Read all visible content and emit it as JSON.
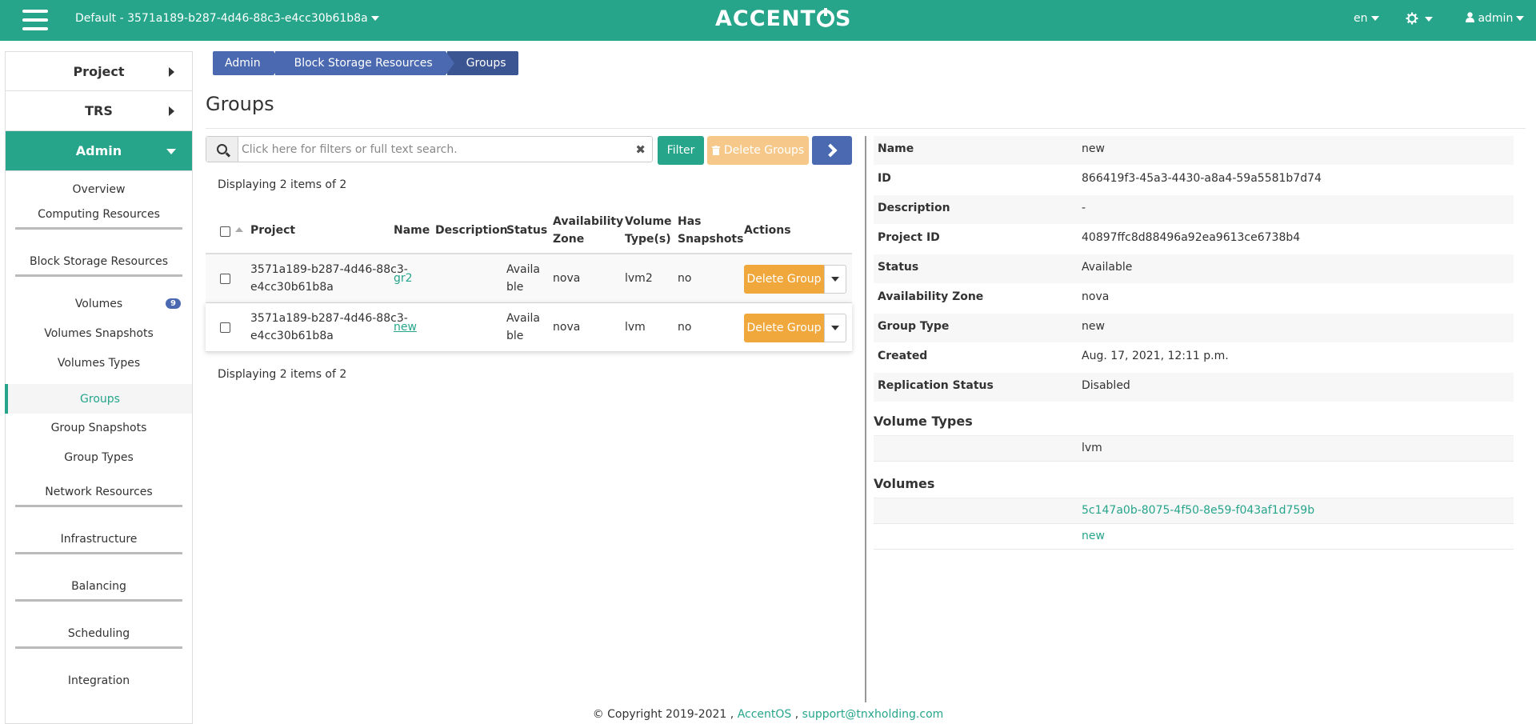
{
  "header": {
    "project_label": "Default - 3571a189-b287-4d46-88c3-e4cc30b61b8a",
    "logo_left": "ACCENT",
    "logo_right": "S",
    "language": "en",
    "user": "admin"
  },
  "sidebar": {
    "project": "Project",
    "trs": "TRS",
    "admin": "Admin",
    "items": {
      "overview": "Overview",
      "computing": "Computing Resources",
      "block_storage": "Block Storage Resources",
      "volumes": "Volumes",
      "volumes_badge": "9",
      "volumes_snapshots": "Volumes Snapshots",
      "volumes_types": "Volumes Types",
      "groups": "Groups",
      "group_snapshots": "Group Snapshots",
      "group_types": "Group Types",
      "network": "Network Resources",
      "infrastructure": "Infrastructure",
      "balancing": "Balancing",
      "scheduling": "Scheduling",
      "integration": "Integration"
    }
  },
  "breadcrumb": [
    "Admin",
    "Block Storage Resources",
    "Groups"
  ],
  "page_title": "Groups",
  "toolbar": {
    "search_placeholder": "Click here for filters or full text search.",
    "clear": "✖",
    "filter": "Filter",
    "delete_groups": "Delete Groups",
    "delete_groups_icon": "trash-icon"
  },
  "table": {
    "count_text": "Displaying 2 items of 2",
    "headers": {
      "project": "Project",
      "name": "Name",
      "description": "Description",
      "status": "Status",
      "az_1": "Availability",
      "az_2": "Zone",
      "vt_1": "Volume",
      "vt_2": "Type(s)",
      "hs_1": "Has",
      "hs_2": "Snapshots",
      "actions": "Actions"
    },
    "rows": [
      {
        "project_1": "3571a189-b287-4d46-88c3-",
        "project_2": "e4cc30b61b8a",
        "name": "gr2",
        "description": "",
        "status_1": "Availa",
        "status_2": "ble",
        "az": "nova",
        "volume_types": "lvm2",
        "has_snapshots": "no",
        "action": "Delete Group"
      },
      {
        "project_1": "3571a189-b287-4d46-88c3-",
        "project_2": "e4cc30b61b8a",
        "name": "new",
        "description": "",
        "status_1": "Availa",
        "status_2": "ble",
        "az": "nova",
        "volume_types": "lvm",
        "has_snapshots": "no",
        "action": "Delete Group"
      }
    ]
  },
  "detail": {
    "fields": [
      {
        "label": "Name",
        "value": "new"
      },
      {
        "label": "ID",
        "value": "866419f3-45a3-4430-a8a4-59a5581b7d74"
      },
      {
        "label": "Description",
        "value": "-"
      },
      {
        "label": "Project ID",
        "value": "40897ffc8d88496a92ea9613ce6738b4"
      },
      {
        "label": "Status",
        "value": "Available"
      },
      {
        "label": "Availability Zone",
        "value": "nova"
      },
      {
        "label": "Group Type",
        "value": "new"
      },
      {
        "label": "Created",
        "value": "Aug. 17, 2021, 12:11 p.m."
      },
      {
        "label": "Replication Status",
        "value": "Disabled"
      }
    ],
    "volume_types_heading": "Volume Types",
    "volume_types": [
      "lvm"
    ],
    "volumes_heading": "Volumes",
    "volumes": [
      "5c147a0b-8075-4f50-8e59-f043af1d759b",
      "new"
    ]
  },
  "footer": {
    "copyright": "© Copyright 2019-2021 ,",
    "brand": "AccentOS",
    "sep": ",",
    "email": "support@tnxholding.com"
  },
  "colors": {
    "primary": "#26a58b",
    "breadcrumb": "#4a69b1",
    "delete": "#f0a73c"
  }
}
